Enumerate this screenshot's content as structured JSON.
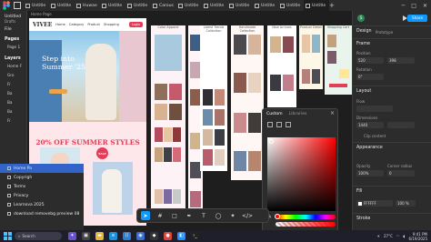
{
  "app": {
    "tabs": [
      {
        "label": "Untitle"
      },
      {
        "label": "Untitle"
      },
      {
        "label": "Huwae"
      },
      {
        "label": "Untitle"
      },
      {
        "label": "Untitle"
      },
      {
        "label": "Carous"
      },
      {
        "label": "Untitle"
      },
      {
        "label": "Untitle"
      },
      {
        "label": "Untitle"
      },
      {
        "label": "Untitle"
      },
      {
        "label": "Untitle"
      },
      {
        "label": "Untitle"
      }
    ]
  },
  "left": {
    "file_title": "Untitled",
    "file_sub": "Drafts",
    "file_tab": "File",
    "pages": "Pages",
    "page_item": "Page 1",
    "layers": "Layers",
    "layer_home": "Home F",
    "layer_items": [
      "Gro",
      "Fr",
      "Ba",
      "Ba",
      "Ba",
      "Fr"
    ]
  },
  "layerlist": {
    "rows": [
      {
        "label": "Home Pa",
        "selected": true
      },
      {
        "label": "Copyrigh"
      },
      {
        "label": "Terms"
      },
      {
        "label": "Privacy"
      },
      {
        "label": "Learnova 2025"
      },
      {
        "label": "download removebg preview 08"
      }
    ]
  },
  "board": {
    "label": "Home Page",
    "logo": "VIVEE",
    "menu": [
      "Home",
      "Category",
      "Product",
      "Shopping"
    ],
    "login": "Login",
    "headline": "Step into Summer '25",
    "sale": "20% OFF SUMMER STYLES",
    "badge": "SALE"
  },
  "frames": {
    "f1": "Color Apparel",
    "f2": "Latest Trends Collection",
    "f3": "Handmade Collection",
    "f4": "New Arrivals",
    "f5": "Product Detail",
    "f6": "Shopping Cart",
    "f7": "Order Summary"
  },
  "right": {
    "avatar": "S",
    "share": "Share",
    "tab_design": "Design",
    "tab_prototype": "Prototype",
    "frame_label": "Frame",
    "position": "Position",
    "x": "520",
    "y": "398",
    "rotation": "Rotation",
    "rotation_val": "0°",
    "layout": "Layout",
    "flow": "Flow",
    "dimensions": "Dimensions",
    "w": "1440",
    "clip": "Clip content",
    "appearance": "Appearance",
    "opacity_label": "Opacity",
    "corner_label": "Corner radius",
    "opacity": "100%",
    "corner": "0",
    "fill": "Fill",
    "fill_hex": "FFFFFF",
    "fill_pct": "100 %",
    "stroke": "Stroke",
    "colors": {
      "accent": "#0d99ff",
      "fill": "#FFFFFF"
    }
  },
  "picker": {
    "tab_custom": "Custom",
    "tab_libraries": "Libraries"
  },
  "toolbar": {
    "tools": [
      "move-tool",
      "frame-tool",
      "shape-tool",
      "pen-tool",
      "text-tool",
      "comment-tool",
      "actions-tool",
      "dev-mode"
    ]
  },
  "taskbar": {
    "search": "Search",
    "weather": "27°C",
    "time": "9:41 PM",
    "date": "6/19/2025"
  }
}
